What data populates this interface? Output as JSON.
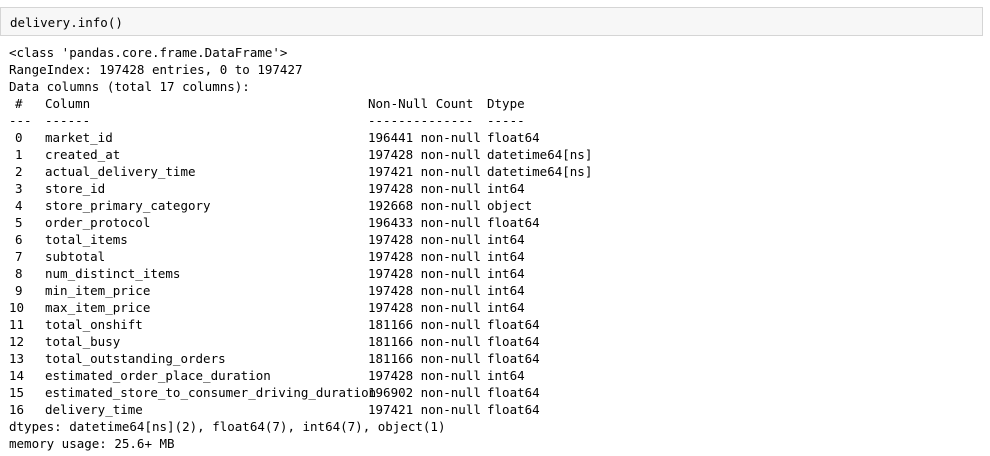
{
  "cell": {
    "code": "delivery.info()"
  },
  "output": {
    "class_line": "<class 'pandas.core.frame.DataFrame'>",
    "range_index": "RangeIndex: 197428 entries, 0 to 197427",
    "data_columns": "Data columns (total 17 columns):",
    "header": {
      "idx": "#",
      "column": "Column",
      "count": "Non-Null Count",
      "dtype": "Dtype"
    },
    "separator": {
      "idx": "---",
      "column": "------",
      "count": "--------------",
      "dtype": "-----"
    },
    "rows": [
      {
        "idx": "0",
        "column": "market_id",
        "count": "196441 non-null",
        "dtype": "float64"
      },
      {
        "idx": "1",
        "column": "created_at",
        "count": "197428 non-null",
        "dtype": "datetime64[ns]"
      },
      {
        "idx": "2",
        "column": "actual_delivery_time",
        "count": "197421 non-null",
        "dtype": "datetime64[ns]"
      },
      {
        "idx": "3",
        "column": "store_id",
        "count": "197428 non-null",
        "dtype": "int64"
      },
      {
        "idx": "4",
        "column": "store_primary_category",
        "count": "192668 non-null",
        "dtype": "object"
      },
      {
        "idx": "5",
        "column": "order_protocol",
        "count": "196433 non-null",
        "dtype": "float64"
      },
      {
        "idx": "6",
        "column": "total_items",
        "count": "197428 non-null",
        "dtype": "int64"
      },
      {
        "idx": "7",
        "column": "subtotal",
        "count": "197428 non-null",
        "dtype": "int64"
      },
      {
        "idx": "8",
        "column": "num_distinct_items",
        "count": "197428 non-null",
        "dtype": "int64"
      },
      {
        "idx": "9",
        "column": "min_item_price",
        "count": "197428 non-null",
        "dtype": "int64"
      },
      {
        "idx": "10",
        "column": "max_item_price",
        "count": "197428 non-null",
        "dtype": "int64"
      },
      {
        "idx": "11",
        "column": "total_onshift",
        "count": "181166 non-null",
        "dtype": "float64"
      },
      {
        "idx": "12",
        "column": "total_busy",
        "count": "181166 non-null",
        "dtype": "float64"
      },
      {
        "idx": "13",
        "column": "total_outstanding_orders",
        "count": "181166 non-null",
        "dtype": "float64"
      },
      {
        "idx": "14",
        "column": "estimated_order_place_duration",
        "count": "197428 non-null",
        "dtype": "int64"
      },
      {
        "idx": "15",
        "column": "estimated_store_to_consumer_driving_duration",
        "count": "196902 non-null",
        "dtype": "float64"
      },
      {
        "idx": "16",
        "column": "delivery_time",
        "count": "197421 non-null",
        "dtype": "float64"
      }
    ],
    "dtypes_line": "dtypes: datetime64[ns](2), float64(7), int64(7), object(1)",
    "memory_line": "memory usage: 25.6+ MB"
  }
}
